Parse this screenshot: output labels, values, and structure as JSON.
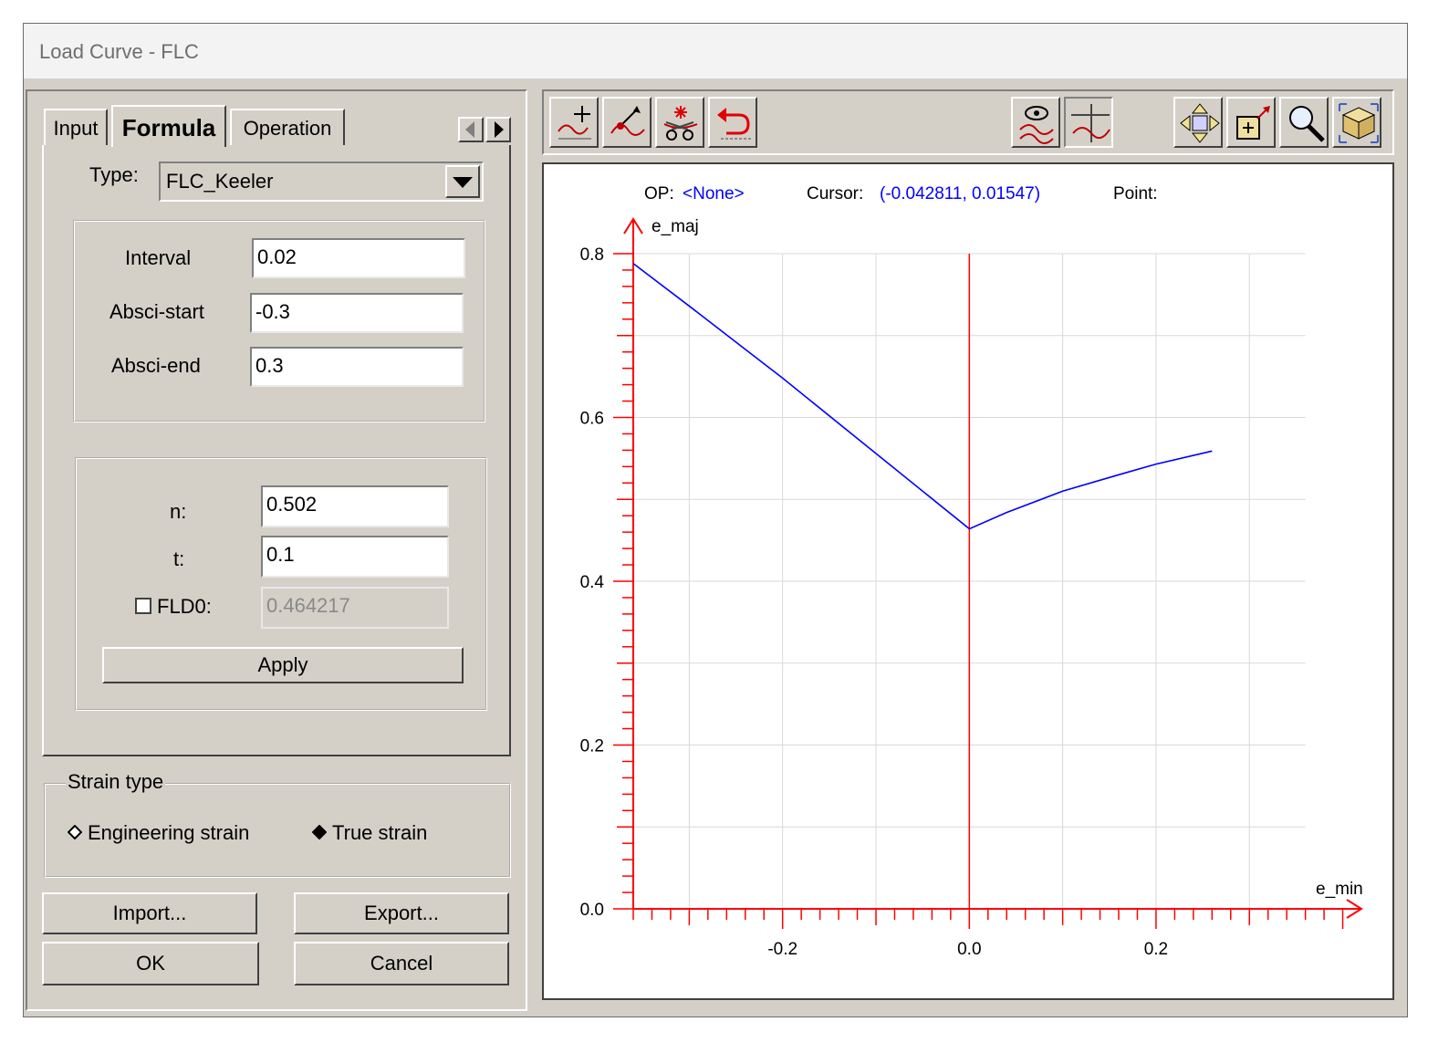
{
  "window": {
    "title": "Load Curve - FLC"
  },
  "tabs": [
    {
      "label": "Input",
      "active": false
    },
    {
      "label": "Formula",
      "active": true
    },
    {
      "label": "Operation",
      "active": false
    }
  ],
  "formula": {
    "type_label": "Type:",
    "type_value": "FLC_Keeler",
    "interval_label": "Interval",
    "interval_value": "0.02",
    "absci_start_label": "Absci-start",
    "absci_start_value": "-0.3",
    "absci_end_label": "Absci-end",
    "absci_end_value": "0.3",
    "n_label": "n:",
    "n_value": "0.502",
    "t_label": "t:",
    "t_value": "0.1",
    "fld0_label": "FLD0:",
    "fld0_value": "0.464217",
    "fld0_checked": false,
    "apply_label": "Apply"
  },
  "strain_type": {
    "legend": "Strain type",
    "options": [
      "Engineering strain",
      "True strain"
    ],
    "selected": "True strain"
  },
  "buttons": {
    "import": "Import...",
    "export": "Export...",
    "ok": "OK",
    "cancel": "Cancel"
  },
  "toolbar": {
    "icons": [
      "add-point-icon",
      "move-point-icon",
      "delete-point-icon",
      "undo-icon",
      "show-curve-icon",
      "crosshair-curve-icon",
      "pan-icon",
      "zoom-box-icon",
      "magnifier-icon",
      "fit-view-icon"
    ]
  },
  "status": {
    "op_label": "OP:",
    "op_value": "<None>",
    "cursor_label": "Cursor:",
    "cursor_value": "(-0.042811, 0.01547)",
    "point_label": "Point:"
  },
  "chart_data": {
    "type": "line",
    "xlabel": "e_min",
    "ylabel": "e_maj",
    "xlim": [
      -0.36,
      0.42
    ],
    "ylim": [
      0.0,
      0.8
    ],
    "xticks": [
      "-0.2",
      "0.0",
      "0.2"
    ],
    "yticks": [
      "0.0",
      "0.2",
      "0.4",
      "0.6",
      "0.8"
    ],
    "grid": true,
    "series": [
      {
        "color": "#0000ff",
        "x": [
          -0.36,
          -0.3,
          -0.2,
          -0.1,
          0.0,
          0.04,
          0.1,
          0.16,
          0.2,
          0.26
        ],
        "y": [
          0.788,
          0.736,
          0.648,
          0.556,
          0.464,
          0.484,
          0.51,
          0.53,
          0.543,
          0.559
        ]
      }
    ],
    "axis_color": "#ff0000",
    "grid_color": "#d9d9d9"
  }
}
